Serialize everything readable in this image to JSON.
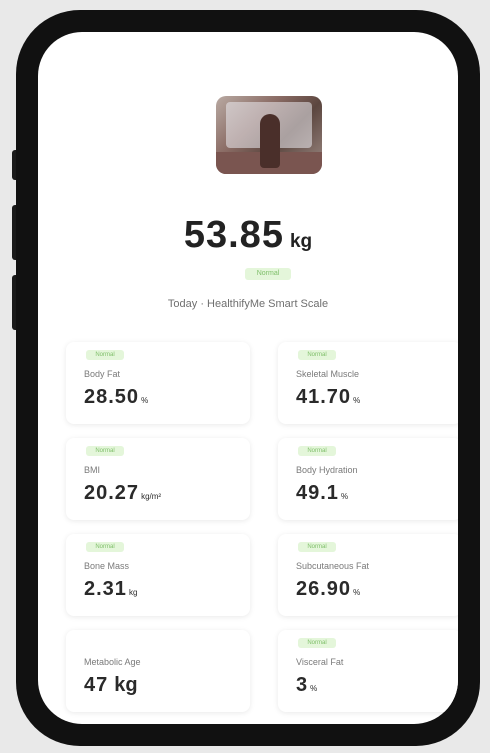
{
  "profile": {
    "photo_icon": "user-photo"
  },
  "weight": {
    "value": "53.85",
    "unit": "kg",
    "status": "Normal"
  },
  "subtitle": "Today · HealthifyMe Smart Scale",
  "metrics": [
    {
      "label": "Body Fat",
      "value": "28.50",
      "unit": "%",
      "status": "Normal"
    },
    {
      "label": "Skeletal Muscle",
      "value": "41.70",
      "unit": "%",
      "status": "Normal"
    },
    {
      "label": "BMI",
      "value": "20.27",
      "unit": "kg/m²",
      "status": "Normal"
    },
    {
      "label": "Body Hydration",
      "value": "49.1",
      "unit": "%",
      "status": "Normal"
    },
    {
      "label": "Bone Mass",
      "value": "2.31",
      "unit": "kg",
      "status": "Normal"
    },
    {
      "label": "Subcutaneous Fat",
      "value": "26.90",
      "unit": "%",
      "status": "Normal"
    },
    {
      "label": "Metabolic Age",
      "value": "47",
      "unit": "kg",
      "status": ""
    },
    {
      "label": "Visceral Fat",
      "value": "3",
      "unit": "%",
      "status": "Normal"
    }
  ]
}
